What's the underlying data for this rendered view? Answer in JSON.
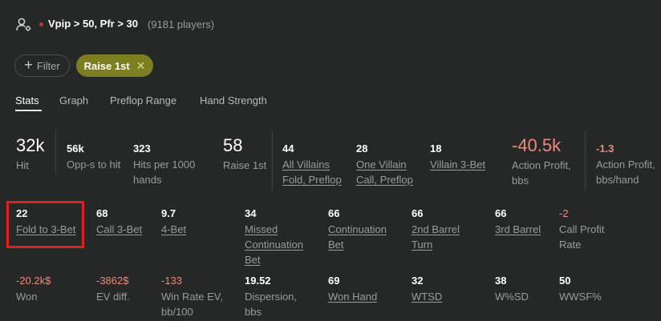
{
  "header": {
    "user_icon": "user-settings-icon",
    "title": "Vpip > 50, Pfr > 30",
    "players": "(9181 players)"
  },
  "chips": {
    "filter_label": "Filter",
    "active_label": "Raise 1st",
    "active_color": "#7c7e20"
  },
  "tabs": [
    "Stats",
    "Graph",
    "Preflop Range",
    "Hand Strength"
  ],
  "row1": {
    "hit": {
      "value": "32k",
      "label": "Hit"
    },
    "opps": {
      "value": "56k",
      "label": "Opp-s to hit"
    },
    "hits_per": {
      "value": "323",
      "label1": "Hits per 1000",
      "label2": "hands"
    },
    "raise": {
      "value": "58",
      "label": "Raise 1st"
    },
    "all_villains": {
      "value": "44",
      "label1": "All Villains",
      "label2": "Fold, Preflop"
    },
    "one_villain": {
      "value": "28",
      "label1": "One Villain",
      "label2": "Call, Preflop"
    },
    "villain3bet": {
      "value": "18",
      "label": "Villain 3-Bet"
    },
    "action_profit": {
      "value": "-40.5k",
      "label1": "Action Profit,",
      "label2": "bbs"
    },
    "action_profit_hand": {
      "value": "-1.3",
      "label1": "Action Profit,",
      "label2": "bbs/hand"
    }
  },
  "row2": {
    "fold3bet": {
      "value": "22",
      "label": "Fold to 3-Bet"
    },
    "call3bet": {
      "value": "68",
      "label": "Call 3-Bet"
    },
    "fourbet": {
      "value": "9.7",
      "label": "4-Bet"
    },
    "missed_cb": {
      "value": "34",
      "label1": "Missed",
      "label2": "Continuation",
      "label3": "Bet"
    },
    "cont_bet": {
      "value": "66",
      "label1": "Continuation",
      "label2": "Bet"
    },
    "second_barrel": {
      "value": "66",
      "label1": "2nd Barrel",
      "label2": "Turn"
    },
    "third_barrel": {
      "value": "66",
      "label": "3rd Barrel"
    },
    "call_profit": {
      "value": "-2",
      "label1": "Call Profit",
      "label2": "Rate"
    }
  },
  "row3": {
    "won": {
      "value": "-20.2k$",
      "label": "Won"
    },
    "ev_diff": {
      "value": "-3862$",
      "label": "EV diff."
    },
    "win_rate": {
      "value": "-133",
      "label1": "Win Rate EV,",
      "label2": "bb/100"
    },
    "dispersion": {
      "value": "19.52",
      "label1": "Dispersion,",
      "label2": "bbs"
    },
    "won_hand": {
      "value": "69",
      "label": "Won Hand"
    },
    "wtsd": {
      "value": "32",
      "label": "WTSD"
    },
    "wsd": {
      "value": "38",
      "label": "W%SD"
    },
    "wwsf": {
      "value": "50",
      "label": "WWSF%"
    }
  },
  "colors": {
    "background": "#252826",
    "negative": "#ee8a7d",
    "highlight": "#e02020"
  }
}
